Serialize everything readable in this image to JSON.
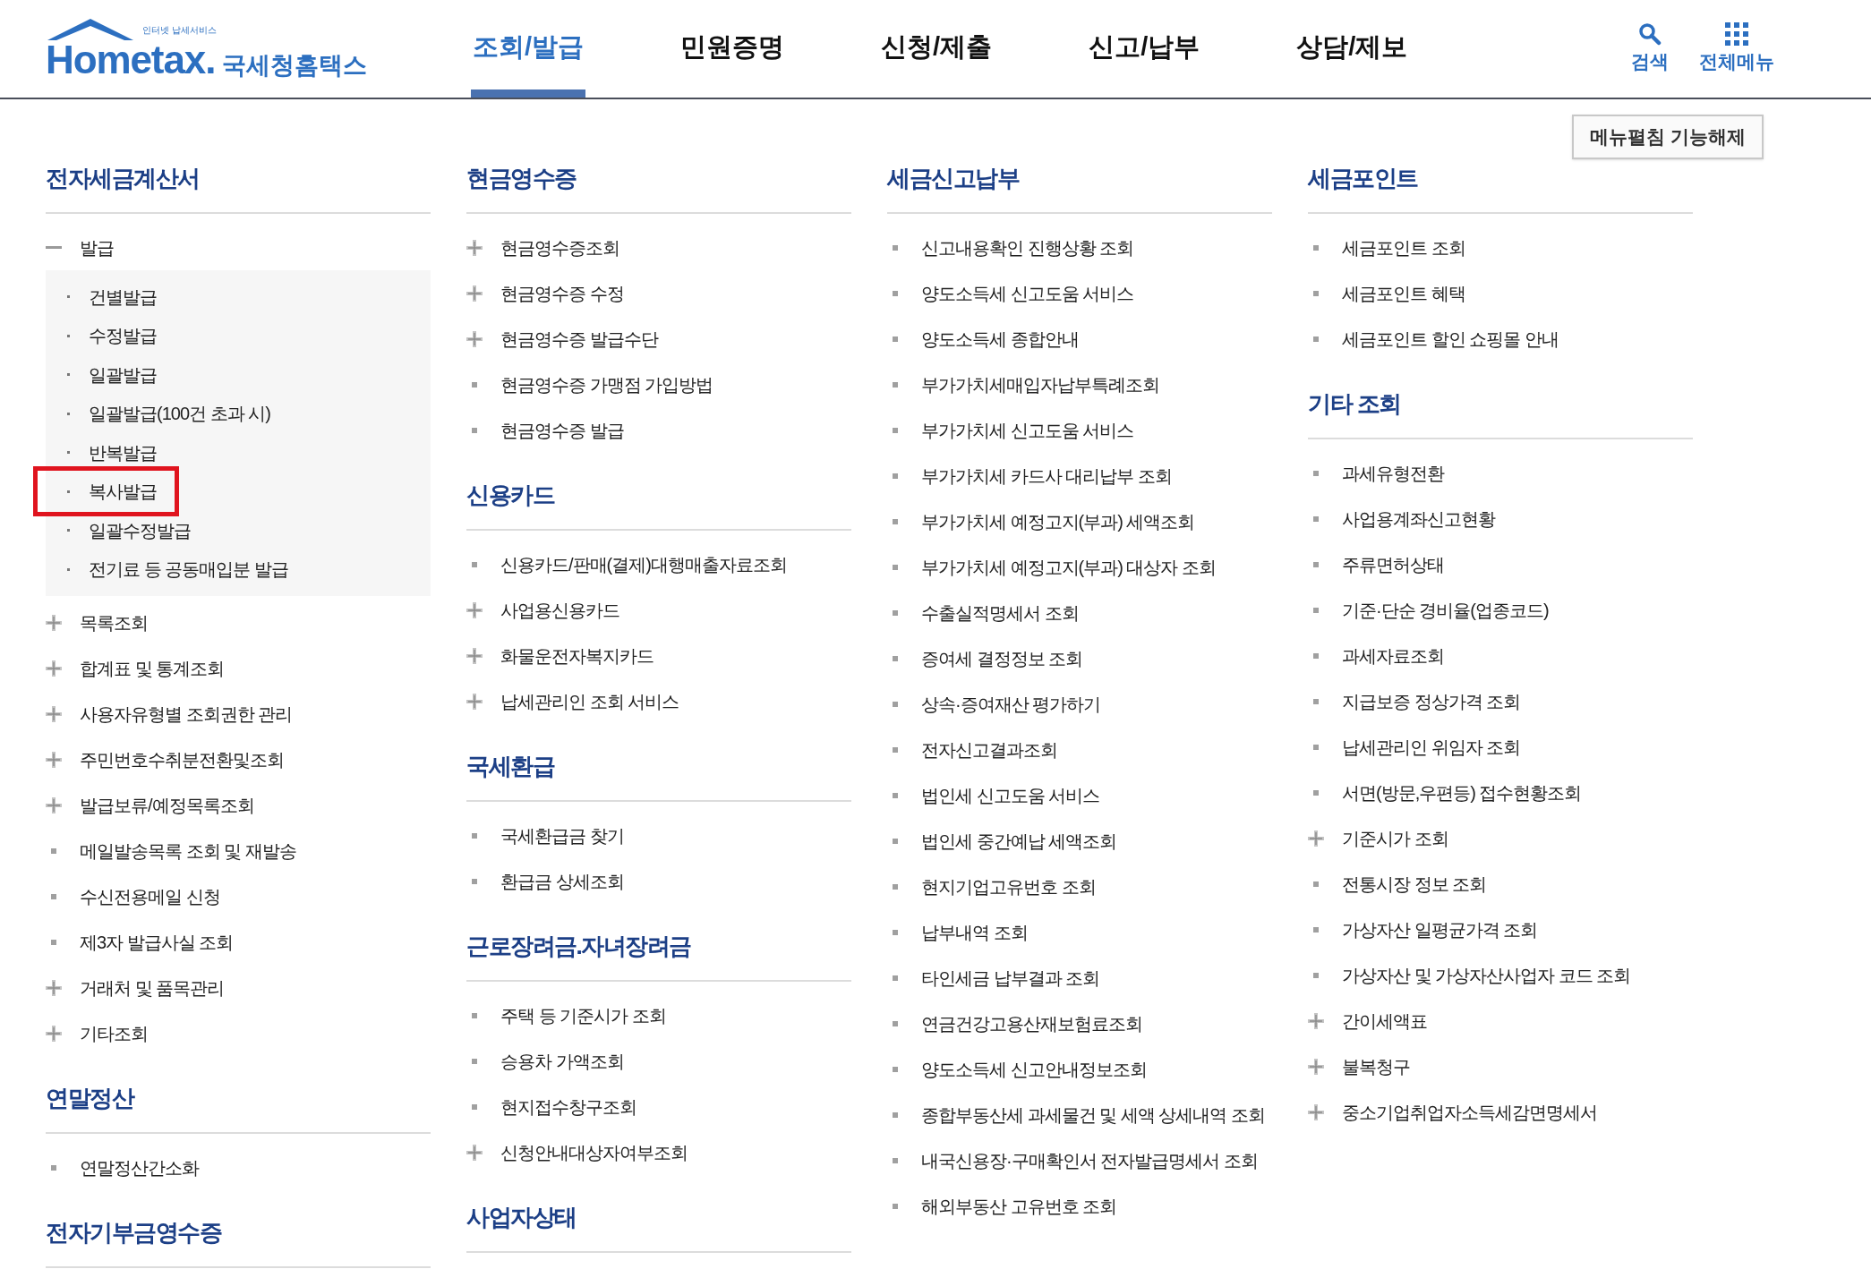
{
  "logo": {
    "tagline": "인터넷 납세서비스",
    "wordmark": "Hometax.",
    "name": "국세청홈택스"
  },
  "nav": [
    {
      "label": "조회/발급",
      "selected": true
    },
    {
      "label": "민원증명",
      "selected": false
    },
    {
      "label": "신청/제출",
      "selected": false
    },
    {
      "label": "신고/납부",
      "selected": false
    },
    {
      "label": "상담/제보",
      "selected": false
    }
  ],
  "header_actions": [
    {
      "kind": "search",
      "label": "검색"
    },
    {
      "kind": "menu",
      "label": "전체메뉴"
    }
  ],
  "toggle_button": "메뉴펼침 기능해제",
  "columns": [
    {
      "sections": [
        {
          "title": "전자세금계산서",
          "items": [
            {
              "label": "발급",
              "kind": "folder",
              "expanded": true,
              "children": [
                {
                  "label": "건별발급",
                  "highlighted": false
                },
                {
                  "label": "수정발급",
                  "highlighted": false
                },
                {
                  "label": "일괄발급",
                  "highlighted": false
                },
                {
                  "label": "일괄발급(100건 초과 시)",
                  "highlighted": false
                },
                {
                  "label": "반복발급",
                  "highlighted": false
                },
                {
                  "label": "복사발급",
                  "highlighted": true
                },
                {
                  "label": "일괄수정발급",
                  "highlighted": false
                },
                {
                  "label": "전기료 등 공동매입분 발급",
                  "highlighted": false
                }
              ]
            },
            {
              "label": "목록조회",
              "kind": "folder",
              "expanded": false
            },
            {
              "label": "합계표 및 통계조회",
              "kind": "folder",
              "expanded": false
            },
            {
              "label": "사용자유형별 조회권한 관리",
              "kind": "folder",
              "expanded": false
            },
            {
              "label": "주민번호수취분전환및조회",
              "kind": "folder",
              "expanded": false
            },
            {
              "label": "발급보류/예정목록조회",
              "kind": "folder",
              "expanded": false
            },
            {
              "label": "메일발송목록 조회 및 재발송",
              "kind": "link"
            },
            {
              "label": "수신전용메일 신청",
              "kind": "link"
            },
            {
              "label": "제3자 발급사실 조회",
              "kind": "link"
            },
            {
              "label": "거래처 및 품목관리",
              "kind": "folder",
              "expanded": false
            },
            {
              "label": "기타조회",
              "kind": "folder",
              "expanded": false
            }
          ]
        },
        {
          "title": "연말정산",
          "items": [
            {
              "label": "연말정산간소화",
              "kind": "link"
            }
          ]
        },
        {
          "title": "전자기부금영수증"
        }
      ]
    },
    {
      "sections": [
        {
          "title": "현금영수증",
          "items": [
            {
              "label": "현금영수증조회",
              "kind": "folder",
              "expanded": false
            },
            {
              "label": "현금영수증 수정",
              "kind": "folder",
              "expanded": false
            },
            {
              "label": "현금영수증 발급수단",
              "kind": "folder",
              "expanded": false
            },
            {
              "label": "현금영수증 가맹점 가입방법",
              "kind": "link"
            },
            {
              "label": "현금영수증 발급",
              "kind": "link"
            }
          ]
        },
        {
          "title": "신용카드",
          "items": [
            {
              "label": "신용카드/판매(결제)대행매출자료조회",
              "kind": "link"
            },
            {
              "label": "사업용신용카드",
              "kind": "folder",
              "expanded": false
            },
            {
              "label": "화물운전자복지카드",
              "kind": "folder",
              "expanded": false
            },
            {
              "label": "납세관리인 조회 서비스",
              "kind": "folder",
              "expanded": false
            }
          ]
        },
        {
          "title": "국세환급",
          "items": [
            {
              "label": "국세환급금 찾기",
              "kind": "link"
            },
            {
              "label": "환급금 상세조회",
              "kind": "link"
            }
          ]
        },
        {
          "title": "근로장려금.자녀장려금",
          "items": [
            {
              "label": "주택 등 기준시가 조회",
              "kind": "link"
            },
            {
              "label": "승용차 가액조회",
              "kind": "link"
            },
            {
              "label": "현지접수창구조회",
              "kind": "link"
            },
            {
              "label": "신청안내대상자여부조회",
              "kind": "folder",
              "expanded": false
            }
          ]
        },
        {
          "title": "사업자상태"
        }
      ]
    },
    {
      "sections": [
        {
          "title": "세금신고납부",
          "items": [
            {
              "label": "신고내용확인 진행상황 조회",
              "kind": "link"
            },
            {
              "label": "양도소득세 신고도움 서비스",
              "kind": "link"
            },
            {
              "label": "양도소득세 종합안내",
              "kind": "link"
            },
            {
              "label": "부가가치세매입자납부특례조회",
              "kind": "link"
            },
            {
              "label": "부가가치세 신고도움 서비스",
              "kind": "link"
            },
            {
              "label": "부가가치세 카드사 대리납부 조회",
              "kind": "link"
            },
            {
              "label": "부가가치세 예정고지(부과) 세액조회",
              "kind": "link"
            },
            {
              "label": "부가가치세 예정고지(부과) 대상자 조회",
              "kind": "link"
            },
            {
              "label": "수출실적명세서 조회",
              "kind": "link"
            },
            {
              "label": "증여세 결정정보 조회",
              "kind": "link"
            },
            {
              "label": "상속·증여재산 평가하기",
              "kind": "link"
            },
            {
              "label": "전자신고결과조회",
              "kind": "link"
            },
            {
              "label": "법인세 신고도움 서비스",
              "kind": "link"
            },
            {
              "label": "법인세 중간예납 세액조회",
              "kind": "link"
            },
            {
              "label": "현지기업고유번호 조회",
              "kind": "link"
            },
            {
              "label": "납부내역 조회",
              "kind": "link"
            },
            {
              "label": "타인세금 납부결과 조회",
              "kind": "link"
            },
            {
              "label": "연금건강고용산재보험료조회",
              "kind": "link"
            },
            {
              "label": "양도소득세 신고안내정보조회",
              "kind": "link"
            },
            {
              "label": "종합부동산세 과세물건 및 세액 상세내역 조회",
              "kind": "link"
            },
            {
              "label": "내국신용장·구매확인서 전자발급명세서 조회",
              "kind": "link"
            },
            {
              "label": "해외부동산 고유번호 조회",
              "kind": "link"
            }
          ]
        }
      ]
    },
    {
      "sections": [
        {
          "title": "세금포인트",
          "items": [
            {
              "label": "세금포인트 조회",
              "kind": "link"
            },
            {
              "label": "세금포인트 혜택",
              "kind": "link"
            },
            {
              "label": "세금포인트 할인 쇼핑몰 안내",
              "kind": "link"
            }
          ]
        },
        {
          "title": "기타 조회",
          "items": [
            {
              "label": "과세유형전환",
              "kind": "link"
            },
            {
              "label": "사업용계좌신고현황",
              "kind": "link"
            },
            {
              "label": "주류면허상태",
              "kind": "link"
            },
            {
              "label": "기준·단순 경비율(업종코드)",
              "kind": "link"
            },
            {
              "label": "과세자료조회",
              "kind": "link"
            },
            {
              "label": "지급보증 정상가격 조회",
              "kind": "link"
            },
            {
              "label": "납세관리인 위임자 조회",
              "kind": "link"
            },
            {
              "label": "서면(방문,우편등) 접수현황조회",
              "kind": "link"
            },
            {
              "label": "기준시가 조회",
              "kind": "folder",
              "expanded": false
            },
            {
              "label": "전통시장 정보 조회",
              "kind": "link"
            },
            {
              "label": "가상자산 일평균가격 조회",
              "kind": "link"
            },
            {
              "label": "가상자산 및 가상자산사업자 코드 조회",
              "kind": "link"
            },
            {
              "label": "간이세액표",
              "kind": "folder",
              "expanded": false
            },
            {
              "label": "불복청구",
              "kind": "folder",
              "expanded": false
            },
            {
              "label": "중소기업취업자소득세감면명세서",
              "kind": "folder",
              "expanded": false
            }
          ]
        }
      ]
    }
  ]
}
